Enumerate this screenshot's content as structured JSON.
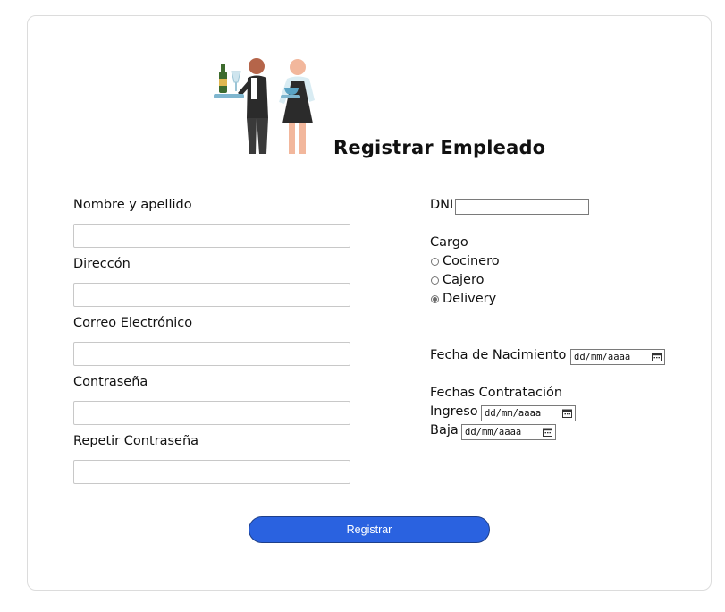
{
  "form": {
    "title": "Registrar Empleado",
    "fields": {
      "nombre_label": "Nombre y apellido",
      "direccion_label": "Direccón",
      "correo_label": "Correo Electrónico",
      "contrasena_label": "Contraseña",
      "repetir_label": "Repetir Contraseña",
      "nombre_value": "",
      "direccion_value": "",
      "correo_value": "",
      "contrasena_value": "",
      "repetir_value": ""
    },
    "dni": {
      "label": "DNI",
      "value": ""
    },
    "cargo": {
      "label": "Cargo",
      "options": [
        "Cocinero",
        "Cajero",
        "Delivery"
      ],
      "selected": "Delivery"
    },
    "nacimiento": {
      "label": "Fecha de Nacimiento",
      "placeholder": "dd/mm/aaaa"
    },
    "contratacion": {
      "label": "Fechas Contratación",
      "ingreso_label": "Ingreso",
      "ingreso_placeholder": "dd/mm/aaaa",
      "baja_label": "Baja",
      "baja_placeholder": "dd/mm/aaaa"
    },
    "submit_label": "Registrar",
    "icons": [
      "waiters-illustration",
      "calendar-icon"
    ],
    "colors": {
      "button": "#2a62e0",
      "button_border": "#1e3f8a"
    }
  }
}
